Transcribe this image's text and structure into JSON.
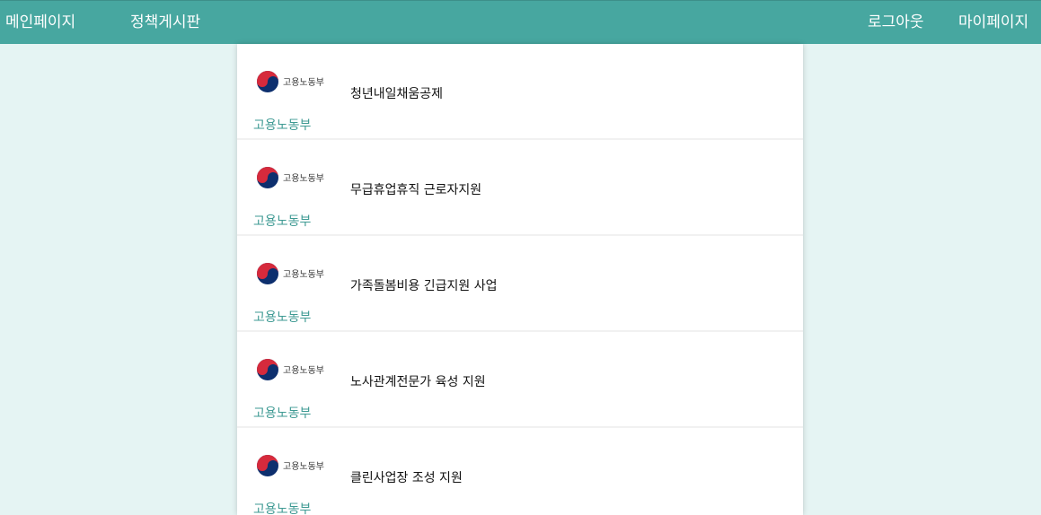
{
  "nav": {
    "main_page": "메인페이지",
    "policy_board": "정책게시판",
    "logout": "로그아웃",
    "my_page": "마이페이지"
  },
  "colors": {
    "nav_bg": "#47a7a0",
    "page_bg": "#e5f4f3",
    "agency_text": "#3e9a93"
  },
  "policies": [
    {
      "logo_text": "고용노동부",
      "title": "청년내일채움공제",
      "agency": "고용노동부"
    },
    {
      "logo_text": "고용노동부",
      "title": "무급휴업휴직 근로자지원",
      "agency": "고용노동부"
    },
    {
      "logo_text": "고용노동부",
      "title": "가족돌봄비용 긴급지원 사업",
      "agency": "고용노동부"
    },
    {
      "logo_text": "고용노동부",
      "title": "노사관계전문가 육성 지원",
      "agency": "고용노동부"
    },
    {
      "logo_text": "고용노동부",
      "title": "클린사업장 조성 지원",
      "agency": "고용노동부"
    }
  ]
}
